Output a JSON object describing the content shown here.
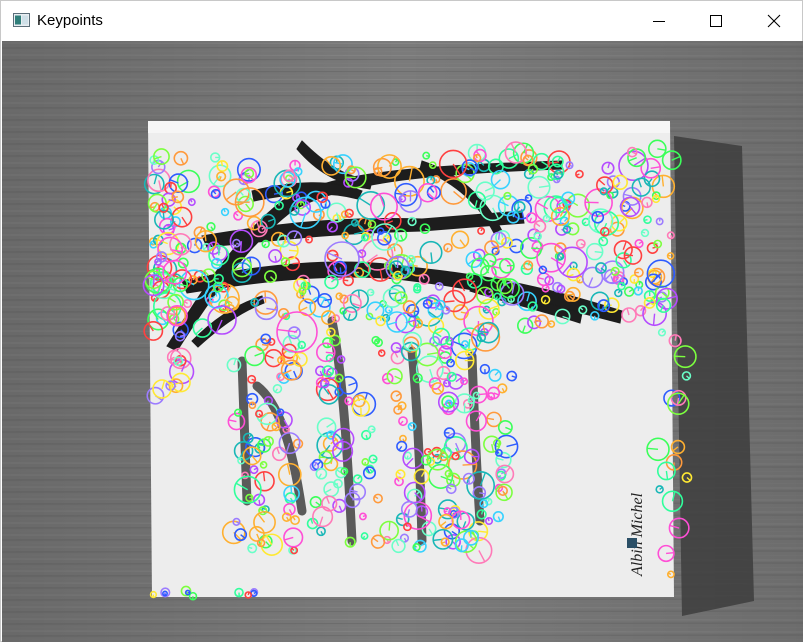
{
  "window": {
    "title": "Keypoints",
    "icons": {
      "app": "opencv-window-icon",
      "minimize": "minimize-icon",
      "maximize": "maximize-icon",
      "close": "close-icon"
    }
  },
  "image": {
    "description_colors": {
      "background": "#7a7a7a",
      "book": "#ececec",
      "branch": "#1e1e1e"
    },
    "book_author_text": "Albin Michel",
    "keypoint_colors": [
      "#ff4fd6",
      "#7cff3f",
      "#37d2ff",
      "#ffb030",
      "#b54cff",
      "#ff4040",
      "#30ff9c",
      "#2e5cff",
      "#ffe933",
      "#ff7ab8",
      "#6affc8",
      "#9c7cff",
      "#ff9a3c",
      "#3cff5a",
      "#19b7b7"
    ]
  }
}
